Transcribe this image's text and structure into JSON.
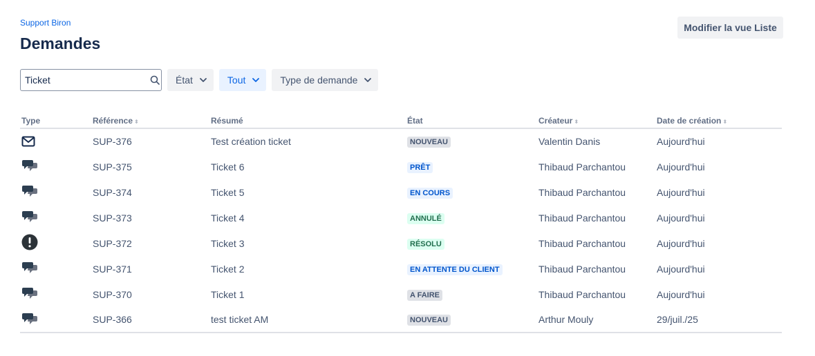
{
  "header": {
    "breadcrumb": "Support Biron",
    "title": "Demandes",
    "edit_button": "Modifier la vue Liste"
  },
  "filters": {
    "search_value": "Ticket",
    "status_label": "État",
    "all_label": "Tout",
    "request_type_label": "Type de demande"
  },
  "table": {
    "headers": {
      "type": "Type",
      "reference": "Référence",
      "summary": "Résumé",
      "status": "État",
      "creator": "Créateur",
      "created": "Date de création"
    },
    "rows": [
      {
        "type": "email-icon",
        "reference": "SUP-376",
        "summary": "Test création ticket",
        "status": "NOUVEAU",
        "status_color": "grey",
        "creator": "Valentin Danis",
        "created": "Aujourd'hui"
      },
      {
        "type": "chat-icon",
        "reference": "SUP-375",
        "summary": "Ticket 6",
        "status": "PRÊT",
        "status_color": "blue",
        "creator": "Thibaud Parchantou",
        "created": "Aujourd'hui"
      },
      {
        "type": "chat-icon",
        "reference": "SUP-374",
        "summary": "Ticket 5",
        "status": "EN COURS",
        "status_color": "blue",
        "creator": "Thibaud Parchantou",
        "created": "Aujourd'hui"
      },
      {
        "type": "chat-icon",
        "reference": "SUP-373",
        "summary": "Ticket 4",
        "status": "ANNULÉ",
        "status_color": "green",
        "creator": "Thibaud Parchantou",
        "created": "Aujourd'hui"
      },
      {
        "type": "alert-icon",
        "reference": "SUP-372",
        "summary": "Ticket 3",
        "status": "RÉSOLU",
        "status_color": "green",
        "creator": "Thibaud Parchantou",
        "created": "Aujourd'hui"
      },
      {
        "type": "chat-icon",
        "reference": "SUP-371",
        "summary": "Ticket 2",
        "status": "EN ATTENTE DU CLIENT",
        "status_color": "blue",
        "creator": "Thibaud Parchantou",
        "created": "Aujourd'hui"
      },
      {
        "type": "chat-icon",
        "reference": "SUP-370",
        "summary": "Ticket 1",
        "status": "A FAIRE",
        "status_color": "grey",
        "creator": "Thibaud Parchantou",
        "created": "Aujourd'hui"
      },
      {
        "type": "chat-icon",
        "reference": "SUP-366",
        "summary": "test ticket AM",
        "status": "NOUVEAU",
        "status_color": "grey",
        "creator": "Arthur Mouly",
        "created": "29/juil./25"
      }
    ]
  },
  "colors": {
    "accent": "#0c66e4",
    "title": "#172b4d",
    "text": "#44546f"
  }
}
